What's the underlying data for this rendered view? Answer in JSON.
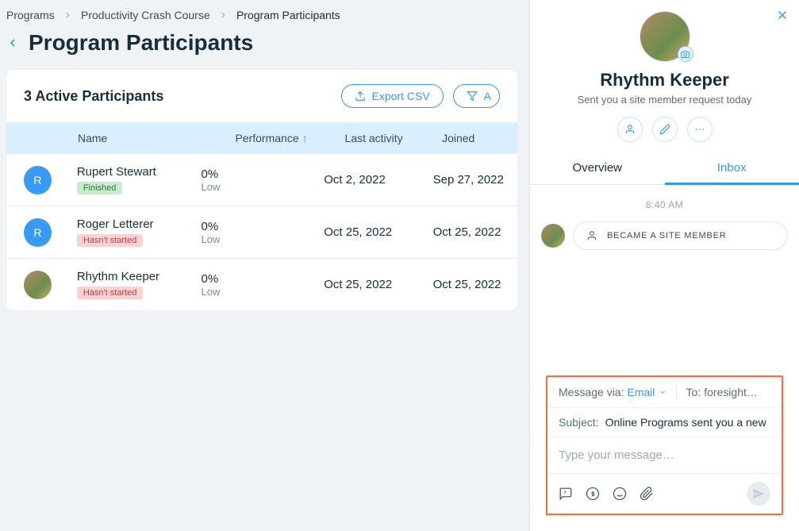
{
  "breadcrumbs": {
    "items": [
      "Programs",
      "Productivity Crash Course",
      "Program Participants"
    ]
  },
  "page": {
    "title": "Program Participants"
  },
  "card": {
    "title": "3 Active Participants",
    "export_label": "Export CSV",
    "filter_label": "A"
  },
  "table": {
    "headers": {
      "name": "Name",
      "performance": "Performance",
      "last_activity": "Last activity",
      "joined": "Joined"
    },
    "rows": [
      {
        "initial": "R",
        "name": "Rupert Stewart",
        "status": "Finished",
        "status_type": "finished",
        "perf_value": "0%",
        "perf_label": "Low",
        "last_activity": "Oct 2, 2022",
        "joined": "Sep 27, 2022",
        "avatar_type": "blue"
      },
      {
        "initial": "R",
        "name": "Roger Letterer",
        "status": "Hasn't started",
        "status_type": "notstarted",
        "perf_value": "0%",
        "perf_label": "Low",
        "last_activity": "Oct 25, 2022",
        "joined": "Oct 25, 2022",
        "avatar_type": "blue"
      },
      {
        "initial": "",
        "name": "Rhythm Keeper",
        "status": "Hasn't started",
        "status_type": "notstarted",
        "perf_value": "0%",
        "perf_label": "Low",
        "last_activity": "Oct 25, 2022",
        "joined": "Oct 25, 2022",
        "avatar_type": "img"
      }
    ]
  },
  "panel": {
    "name": "Rhythm Keeper",
    "subtitle": "Sent you a site member request today",
    "tabs": {
      "overview": "Overview",
      "inbox": "Inbox"
    },
    "time": "8:40 AM",
    "activity": "BECAME A SITE MEMBER",
    "composer": {
      "message_via_label": "Message via:",
      "message_via_value": "Email",
      "to_label": "To:",
      "to_value": "foresight…",
      "subject_label": "Subject:",
      "subject_value": "Online Programs sent you a new",
      "placeholder": "Type your message…"
    }
  }
}
